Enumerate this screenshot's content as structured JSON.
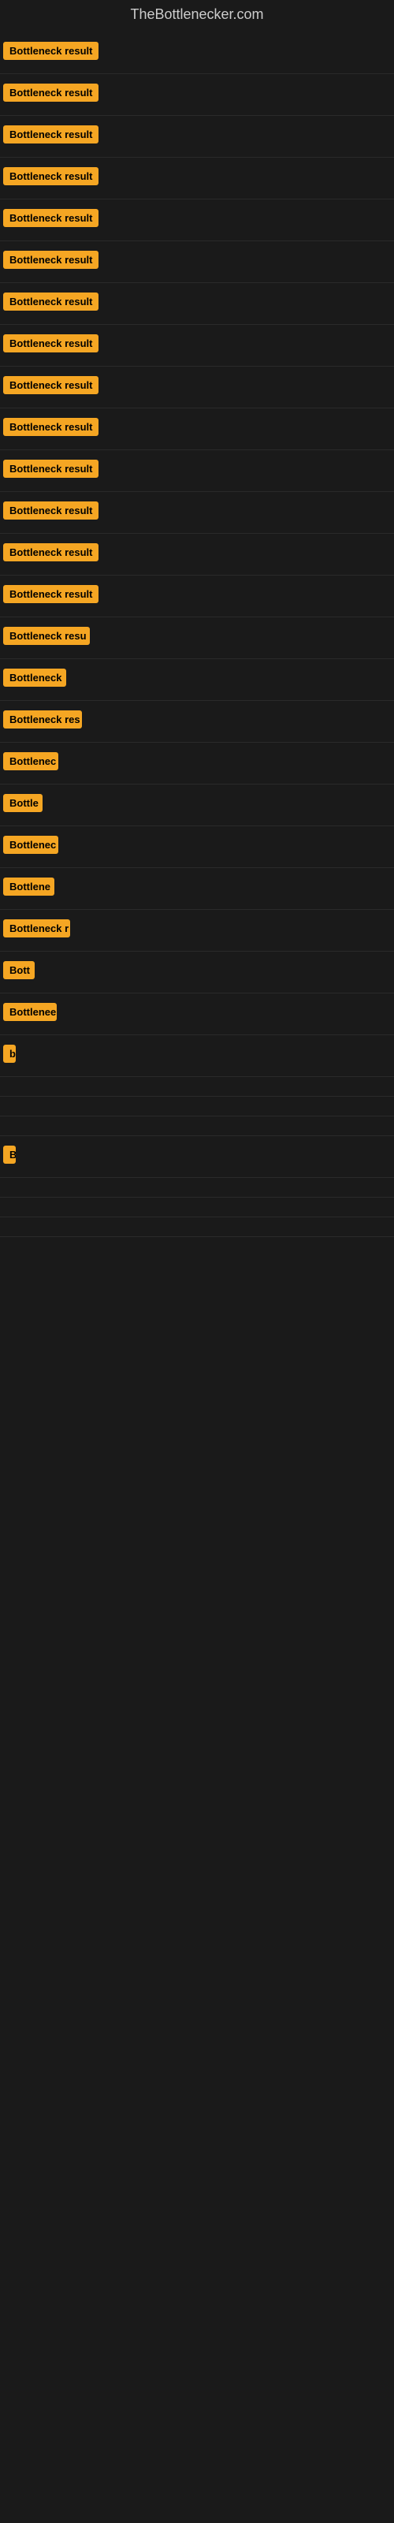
{
  "site": {
    "title": "TheBottlenecker.com"
  },
  "rows": [
    {
      "id": 1,
      "label": "Bottleneck result",
      "width": 130
    },
    {
      "id": 2,
      "label": "Bottleneck result",
      "width": 130
    },
    {
      "id": 3,
      "label": "Bottleneck result",
      "width": 130
    },
    {
      "id": 4,
      "label": "Bottleneck result",
      "width": 130
    },
    {
      "id": 5,
      "label": "Bottleneck result",
      "width": 130
    },
    {
      "id": 6,
      "label": "Bottleneck result",
      "width": 130
    },
    {
      "id": 7,
      "label": "Bottleneck result",
      "width": 130
    },
    {
      "id": 8,
      "label": "Bottleneck result",
      "width": 130
    },
    {
      "id": 9,
      "label": "Bottleneck result",
      "width": 130
    },
    {
      "id": 10,
      "label": "Bottleneck result",
      "width": 130
    },
    {
      "id": 11,
      "label": "Bottleneck result",
      "width": 130
    },
    {
      "id": 12,
      "label": "Bottleneck result",
      "width": 130
    },
    {
      "id": 13,
      "label": "Bottleneck result",
      "width": 130
    },
    {
      "id": 14,
      "label": "Bottleneck result",
      "width": 130
    },
    {
      "id": 15,
      "label": "Bottleneck resu",
      "width": 110
    },
    {
      "id": 16,
      "label": "Bottleneck",
      "width": 80
    },
    {
      "id": 17,
      "label": "Bottleneck res",
      "width": 100
    },
    {
      "id": 18,
      "label": "Bottlenec",
      "width": 70
    },
    {
      "id": 19,
      "label": "Bottle",
      "width": 50
    },
    {
      "id": 20,
      "label": "Bottlenec",
      "width": 70
    },
    {
      "id": 21,
      "label": "Bottlene",
      "width": 65
    },
    {
      "id": 22,
      "label": "Bottleneck r",
      "width": 85
    },
    {
      "id": 23,
      "label": "Bott",
      "width": 40
    },
    {
      "id": 24,
      "label": "Bottlenee",
      "width": 68
    },
    {
      "id": 25,
      "label": "b",
      "width": 12
    },
    {
      "id": 26,
      "label": "",
      "width": 0
    },
    {
      "id": 27,
      "label": "",
      "width": 0
    },
    {
      "id": 28,
      "label": "",
      "width": 0
    },
    {
      "id": 29,
      "label": "B",
      "width": 12
    },
    {
      "id": 30,
      "label": "",
      "width": 0
    },
    {
      "id": 31,
      "label": "",
      "width": 0
    },
    {
      "id": 32,
      "label": "",
      "width": 0
    }
  ]
}
